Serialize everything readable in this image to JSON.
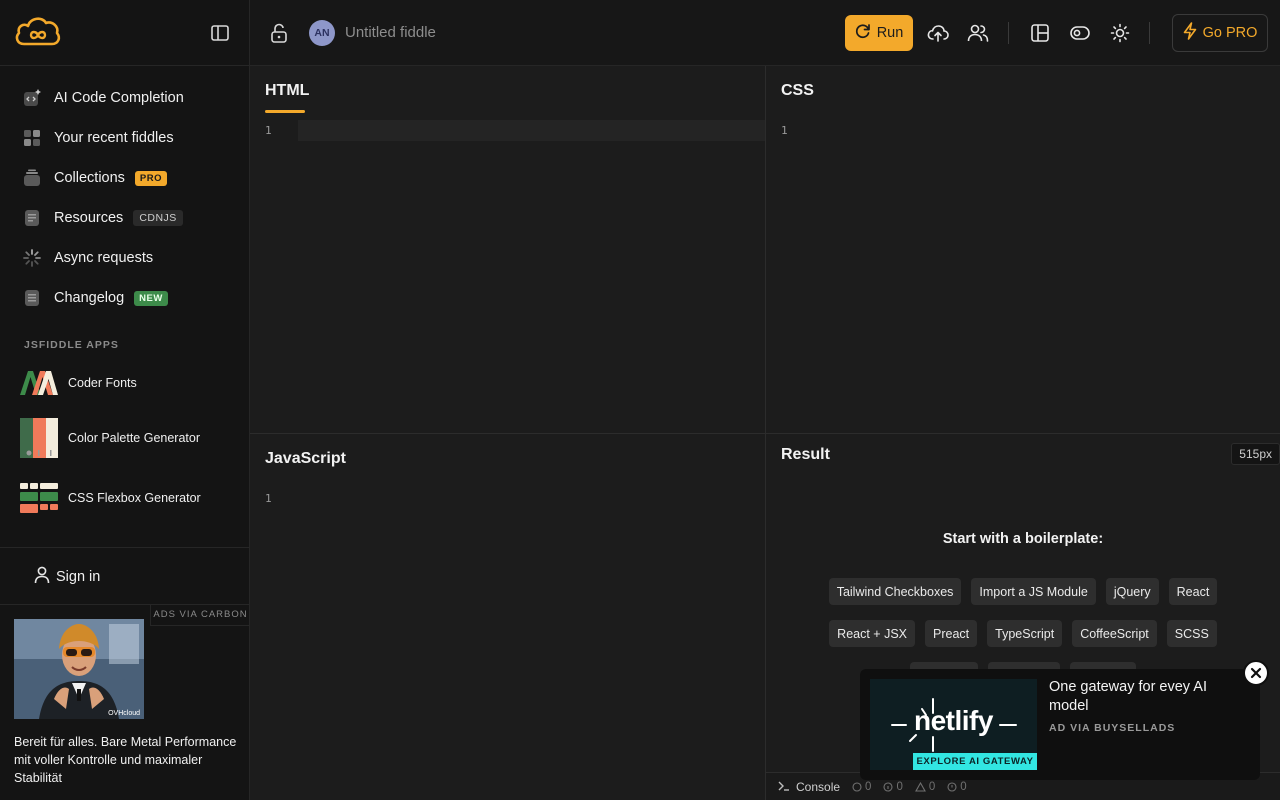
{
  "app": {
    "title": "Untitled fiddle",
    "avatar_initials": "AN",
    "accent": "#f3a92b"
  },
  "toolbar": {
    "run_label": "Run",
    "gopro_label": "Go PRO",
    "icons": [
      "lock-open-icon",
      "upload-cloud-icon",
      "users-icon",
      "layout-icon",
      "toggle-icon",
      "sun-icon"
    ]
  },
  "sidebar": {
    "items": [
      {
        "label": "AI Code Completion",
        "icon": "ai-code-icon"
      },
      {
        "label": "Your recent fiddles",
        "icon": "grid-icon"
      },
      {
        "label": "Collections",
        "badge": "PRO",
        "icon": "collection-icon"
      },
      {
        "label": "Resources",
        "badge": "CDNJS",
        "icon": "document-icon"
      },
      {
        "label": "Async requests",
        "icon": "spinner-icon"
      },
      {
        "label": "Changelog",
        "badge": "NEW",
        "icon": "changelog-icon"
      }
    ],
    "apps_heading": "JSFIDDLE APPS",
    "apps": [
      {
        "label": "Coder Fonts"
      },
      {
        "label": "Color Palette Generator"
      },
      {
        "label": "CSS Flexbox Generator"
      }
    ],
    "signin_label": "Sign in",
    "ad": {
      "via": "ADS VIA CARBON",
      "text": "Bereit für alles. Bare Metal Performance mit voller Kontrolle und maximaler Stabilität",
      "brand_mark": "OVHcloud"
    }
  },
  "panels": {
    "html": {
      "title": "HTML",
      "line": "1"
    },
    "css": {
      "title": "CSS",
      "line": "1"
    },
    "js": {
      "title": "JavaScript",
      "line": "1"
    },
    "result": {
      "title": "Result",
      "size": "515px",
      "boiler_title": "Start with a boilerplate:",
      "chips_row1": [
        "Tailwind Checkboxes",
        "Import a JS Module",
        "jQuery",
        "React"
      ],
      "chips_row2": [
        "React + JSX",
        "Preact",
        "TypeScript",
        "CoffeeScript",
        "SCSS"
      ]
    }
  },
  "console": {
    "label": "Console",
    "counts": [
      "0",
      "0",
      "0",
      "0"
    ]
  },
  "netlify_ad": {
    "text": "One gateway for evey AI model",
    "via": "AD VIA BUYSELLADS",
    "logo_text": "netlify",
    "cta": "EXPLORE AI GATEWAY"
  }
}
